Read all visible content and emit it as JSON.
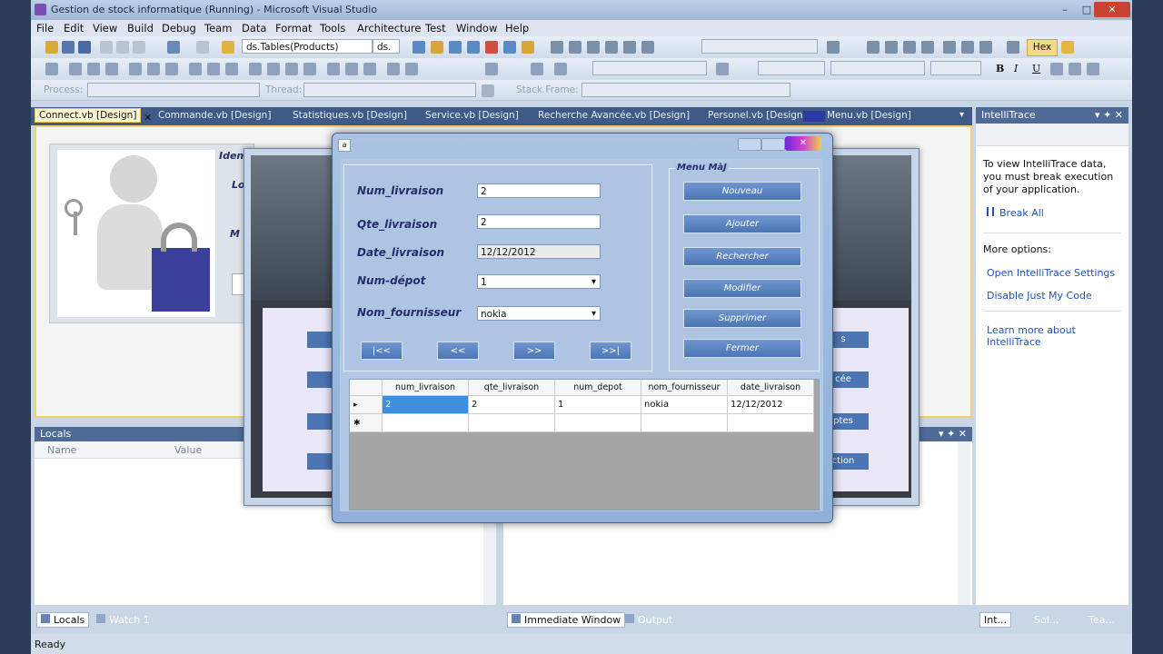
{
  "window": {
    "title": "Gestion de stock informatique (Running) - Microsoft Visual Studio",
    "min": "–",
    "max": "□",
    "close": "✕"
  },
  "menu": [
    "File",
    "Edit",
    "View",
    "Build",
    "Debug",
    "Team",
    "Data",
    "Format",
    "Tools",
    "Architecture",
    "Test",
    "Window",
    "Help"
  ],
  "toolbar": {
    "combo1": "ds.Tables(Products)",
    "combo1b": "ds.",
    "hex": "Hex",
    "process": "Process:",
    "thread": "Thread:",
    "stackframe": "Stack Frame:"
  },
  "doc_tabs": [
    "Connect.vb [Design]",
    "Commande.vb [Design]",
    "Statistiques.vb [Design]",
    "Service.vb [Design]",
    "Recherche Avancée.vb [Design]",
    "Personel.vb [Design]",
    "Menu.vb [Design]"
  ],
  "designer": {
    "ident_label": "Iden",
    "lo": "Lo",
    "m": "M"
  },
  "locals": {
    "title": "Locals",
    "col_name": "Name",
    "col_value": "Value",
    "tabs": [
      "Locals",
      "Watch 1"
    ]
  },
  "immediate": {
    "tabs": [
      "Immediate Window",
      "Output"
    ]
  },
  "intellitrace": {
    "title": "IntelliTrace",
    "intro": "To view IntelliTrace data, you must break execution of your application.",
    "break_all": "Break All",
    "more_options": "More options:",
    "links": [
      "Open IntelliTrace Settings",
      "Disable Just My Code",
      "Learn more about IntelliTrace"
    ],
    "tabs": [
      "Int...",
      "Sol...",
      "Tea..."
    ]
  },
  "status": "Ready",
  "bg_form": {
    "buttons": [
      "s",
      "cée",
      "ptes",
      "ction"
    ]
  },
  "dialog": {
    "icon": "a",
    "fields": [
      {
        "label": "Num_livraison",
        "value": "2"
      },
      {
        "label": "Qte_livraison",
        "value": "2"
      },
      {
        "label": "Date_livraison",
        "value": "12/12/2012"
      },
      {
        "label": "Num-dépot",
        "value": "1"
      },
      {
        "label": "Nom_fournisseur",
        "value": "nokia"
      }
    ],
    "nav": [
      "|<<",
      "<<",
      ">>",
      ">>|"
    ],
    "menu_group": "Menu MàJ",
    "menu_buttons": [
      "Nouveau",
      "Ajouter",
      "Rechercher",
      "Modifier",
      "Supprimer",
      "Fermer"
    ],
    "grid": {
      "columns": [
        "num_livraison",
        "qte_livraison",
        "num_depot",
        "nom_fournisseur",
        "date_livraison"
      ],
      "rows": [
        [
          "2",
          "2",
          "1",
          "nokia",
          "12/12/2012"
        ]
      ],
      "row_marker": "▸",
      "new_row_marker": "✱"
    }
  }
}
